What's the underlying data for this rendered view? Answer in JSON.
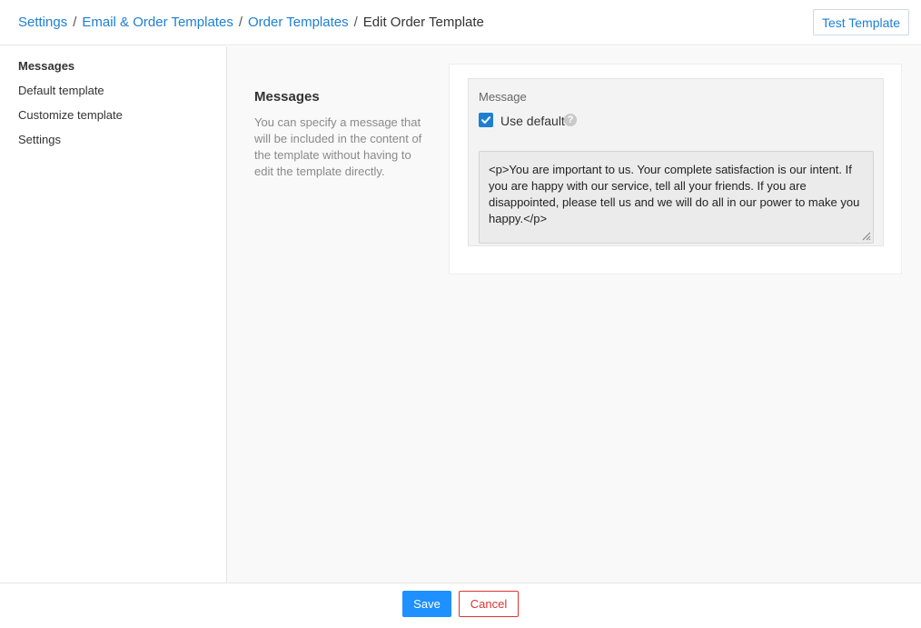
{
  "breadcrumb": {
    "items": [
      "Settings",
      "Email & Order Templates",
      "Order Templates"
    ],
    "current": "Edit Order Template",
    "separator": "/"
  },
  "header": {
    "test_button_label": "Test Template"
  },
  "sidebar": {
    "items": [
      {
        "label": "Messages",
        "active": true
      },
      {
        "label": "Default template",
        "active": false
      },
      {
        "label": "Customize template",
        "active": false
      },
      {
        "label": "Settings",
        "active": false
      }
    ]
  },
  "section": {
    "title": "Messages",
    "description": "You can specify a message that will be included in the content of the template without having to edit the template directly."
  },
  "message_field": {
    "label": "Message",
    "use_default_label": "Use default",
    "use_default_checked": true,
    "help_icon": "question-circle-icon",
    "value": "<p>You are important to us. Your complete satisfaction is our intent. If you are happy with our service, tell all your friends. If you are disappointed, please tell us and we will do all in our power to make you happy.</p>"
  },
  "footer": {
    "save_label": "Save",
    "cancel_label": "Cancel"
  },
  "colors": {
    "link": "#1e7fd1",
    "primary": "#1e90ff",
    "danger": "#dd3333"
  }
}
